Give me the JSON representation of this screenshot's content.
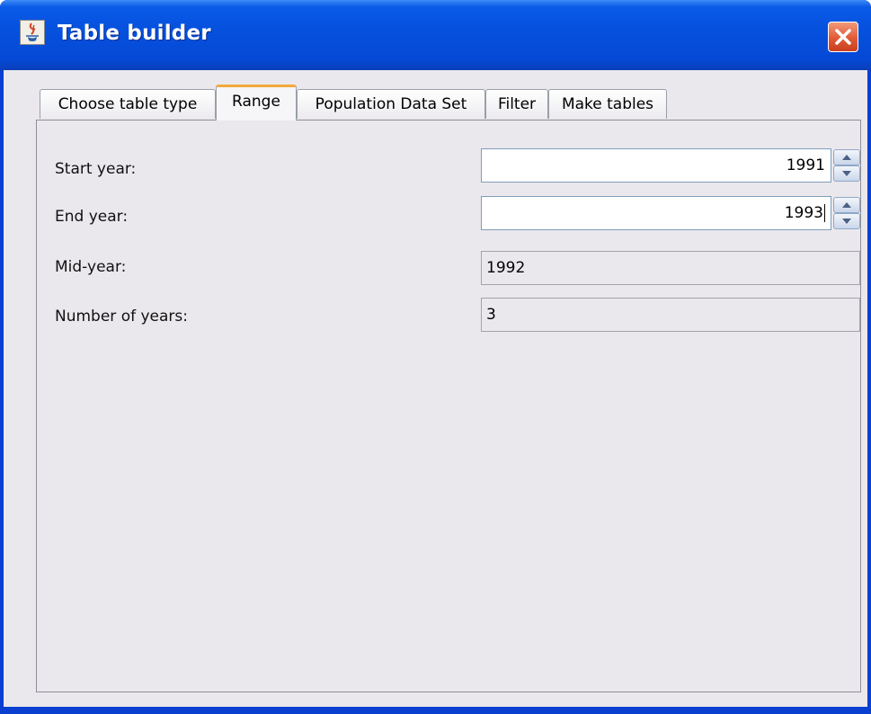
{
  "window": {
    "title": "Table builder"
  },
  "tabs": [
    {
      "label": "Choose table type",
      "active": false
    },
    {
      "label": "Range",
      "active": true
    },
    {
      "label": "Population Data Set",
      "active": false
    },
    {
      "label": "Filter",
      "active": false
    },
    {
      "label": "Make tables",
      "active": false
    }
  ],
  "form": {
    "start_year": {
      "label": "Start year:",
      "value": "1991"
    },
    "end_year": {
      "label": "End year:",
      "value": "1993"
    },
    "mid_year": {
      "label": "Mid-year:",
      "value": "1992"
    },
    "num_years": {
      "label": "Number of years:",
      "value": "3"
    }
  },
  "icons": {
    "app": "java-cup-icon",
    "close": "close-icon",
    "spin_up": "arrow-up-icon",
    "spin_down": "arrow-down-icon"
  },
  "colors": {
    "titlebar": "#0550dd",
    "close_button": "#e05a36",
    "active_tab_accent": "#f2a93b",
    "panel_bg": "#ebe8ed"
  }
}
